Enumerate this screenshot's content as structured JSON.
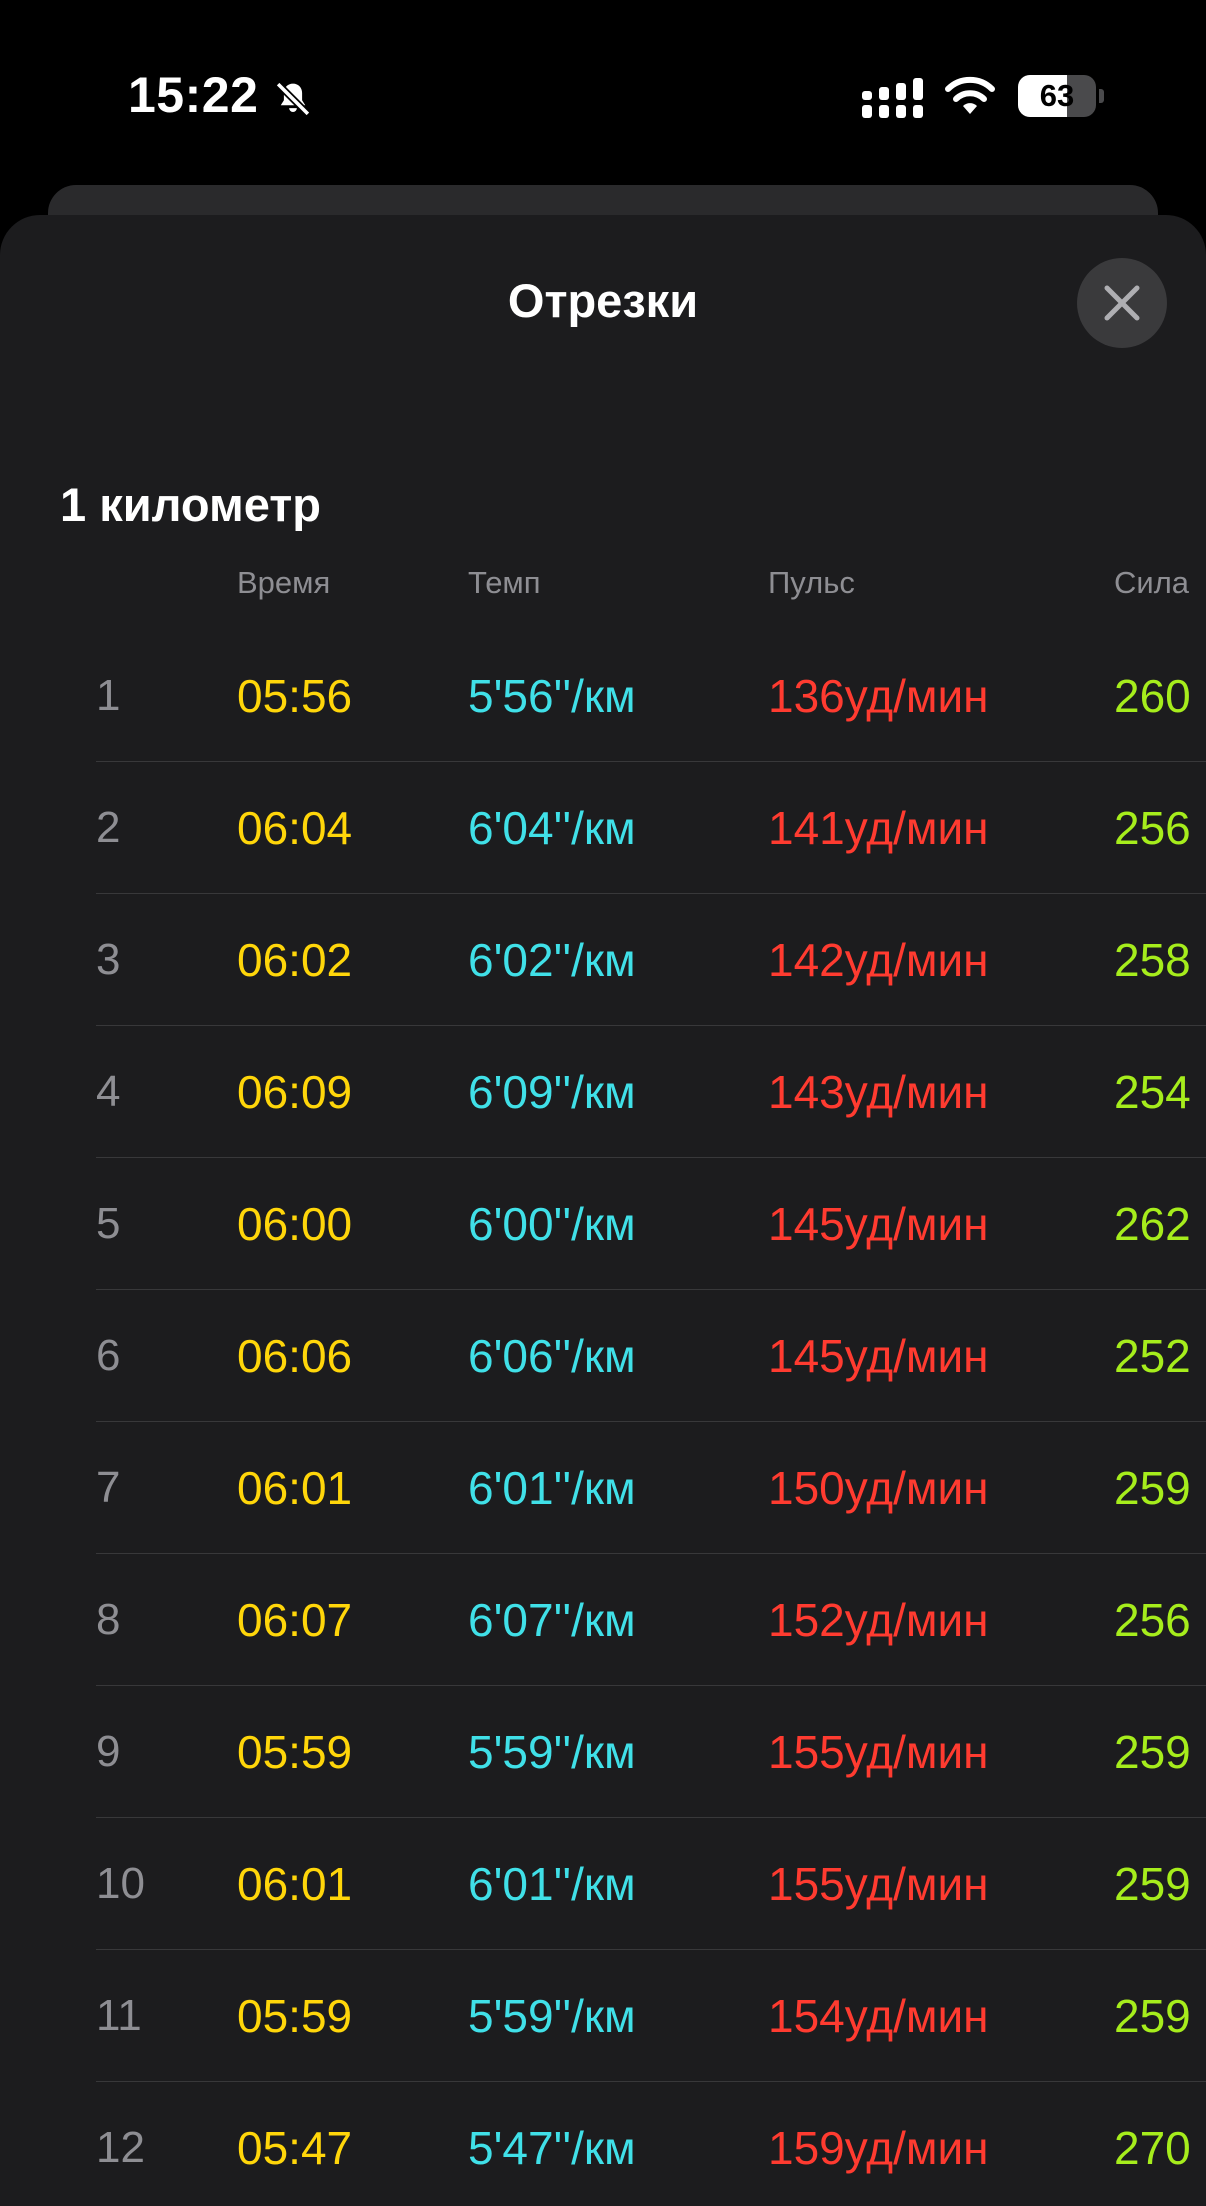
{
  "status_bar": {
    "time": "15:22",
    "battery_level": "63",
    "icons": [
      "bell-slash-icon",
      "cellular-signal-icon",
      "wifi-icon",
      "battery-icon"
    ]
  },
  "sheet": {
    "title": "Отрезки",
    "close_icon": "close-icon"
  },
  "section": {
    "title": "1 километр",
    "columns": {
      "time": "Время",
      "pace": "Темп",
      "heart_rate": "Пульс",
      "power": "Сила"
    }
  },
  "colors": {
    "time": "#ffd60a",
    "pace": "#40e0e8",
    "heart_rate": "#ff3b30",
    "power": "#a6ed1c",
    "sheet_bg": "#1c1c1e"
  },
  "splits": [
    {
      "index": "1",
      "time": "05:56",
      "pace": "5'56''/км",
      "heart_rate": "136уд/мин",
      "power": "260"
    },
    {
      "index": "2",
      "time": "06:04",
      "pace": "6'04''/км",
      "heart_rate": "141уд/мин",
      "power": "256"
    },
    {
      "index": "3",
      "time": "06:02",
      "pace": "6'02''/км",
      "heart_rate": "142уд/мин",
      "power": "258"
    },
    {
      "index": "4",
      "time": "06:09",
      "pace": "6'09''/км",
      "heart_rate": "143уд/мин",
      "power": "254"
    },
    {
      "index": "5",
      "time": "06:00",
      "pace": "6'00''/км",
      "heart_rate": "145уд/мин",
      "power": "262"
    },
    {
      "index": "6",
      "time": "06:06",
      "pace": "6'06''/км",
      "heart_rate": "145уд/мин",
      "power": "252"
    },
    {
      "index": "7",
      "time": "06:01",
      "pace": "6'01''/км",
      "heart_rate": "150уд/мин",
      "power": "259"
    },
    {
      "index": "8",
      "time": "06:07",
      "pace": "6'07''/км",
      "heart_rate": "152уд/мин",
      "power": "256"
    },
    {
      "index": "9",
      "time": "05:59",
      "pace": "5'59''/км",
      "heart_rate": "155уд/мин",
      "power": "259"
    },
    {
      "index": "10",
      "time": "06:01",
      "pace": "6'01''/км",
      "heart_rate": "155уд/мин",
      "power": "259"
    },
    {
      "index": "11",
      "time": "05:59",
      "pace": "5'59''/км",
      "heart_rate": "154уд/мин",
      "power": "259"
    },
    {
      "index": "12",
      "time": "05:47",
      "pace": "5'47''/км",
      "heart_rate": "159уд/мин",
      "power": "270"
    }
  ]
}
